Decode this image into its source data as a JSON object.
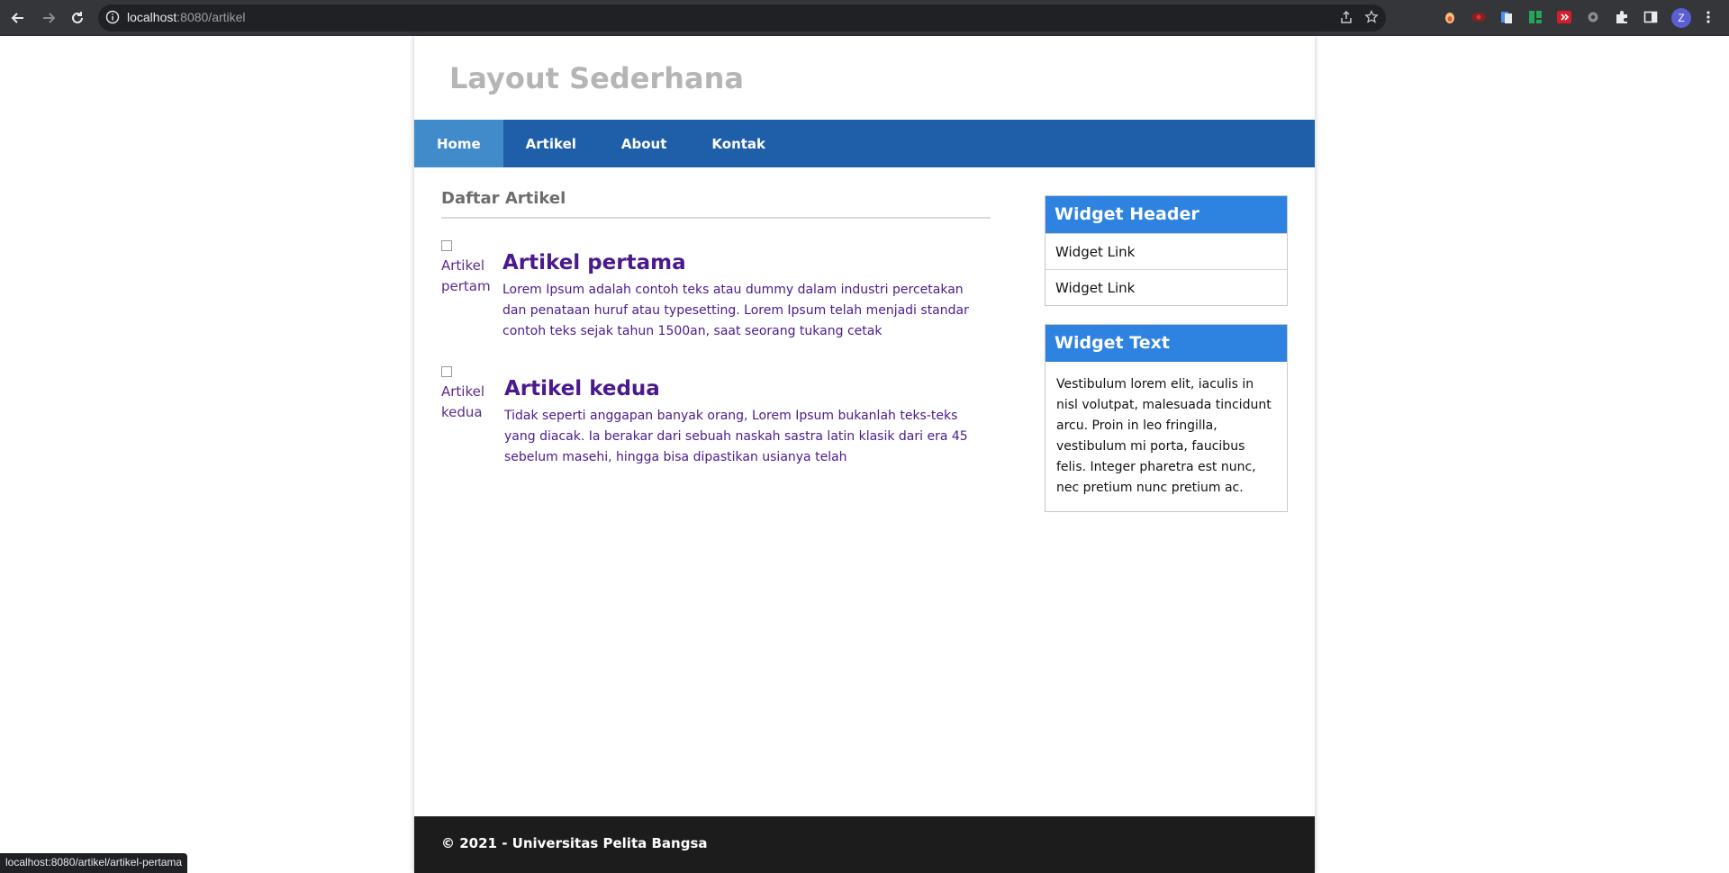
{
  "browser": {
    "url_host": "localhost",
    "url_rest": ":8080/artikel",
    "avatar_letter": "Z",
    "status_url": "localhost:8080/artikel/artikel-pertama"
  },
  "site": {
    "title": "Layout Sederhana",
    "nav": [
      {
        "label": "Home",
        "active": true
      },
      {
        "label": "Artikel",
        "active": false
      },
      {
        "label": "About",
        "active": false
      },
      {
        "label": "Kontak",
        "active": false
      }
    ]
  },
  "main": {
    "title": "Daftar Artikel",
    "articles": [
      {
        "img_alt": "Artikel pertam",
        "title": "Artikel pertama",
        "text": "Lorem Ipsum adalah contoh teks atau dummy dalam industri percetakan dan penataan huruf atau typesetting. Lorem Ipsum telah menjadi standar contoh teks sejak tahun 1500an, saat seorang tukang cetak"
      },
      {
        "img_alt": "Artikel kedua",
        "title": "Artikel kedua",
        "text": "Tidak seperti anggapan banyak orang, Lorem Ipsum bukanlah teks-teks yang diacak. Ia berakar dari sebuah naskah sastra latin klasik dari era 45 sebelum masehi, hingga bisa dipastikan usianya telah"
      }
    ]
  },
  "sidebar": {
    "widget1": {
      "header": "Widget Header",
      "links": [
        "Widget Link",
        "Widget Link"
      ]
    },
    "widget2": {
      "header": "Widget Text",
      "text": "Vestibulum lorem elit, iaculis in nisl volutpat, malesuada tincidunt arcu. Proin in leo fringilla, vestibulum mi porta, faucibus felis. Integer pharetra est nunc, nec pretium nunc pretium ac."
    }
  },
  "footer": {
    "text": "© 2021 - Universitas Pelita Bangsa"
  },
  "colors": {
    "nav_bg": "#1f5faa",
    "nav_active": "#428bca",
    "widget_header": "#2e82e0",
    "article_text": "#4a1a8c",
    "footer_bg": "#1c1c1c"
  }
}
